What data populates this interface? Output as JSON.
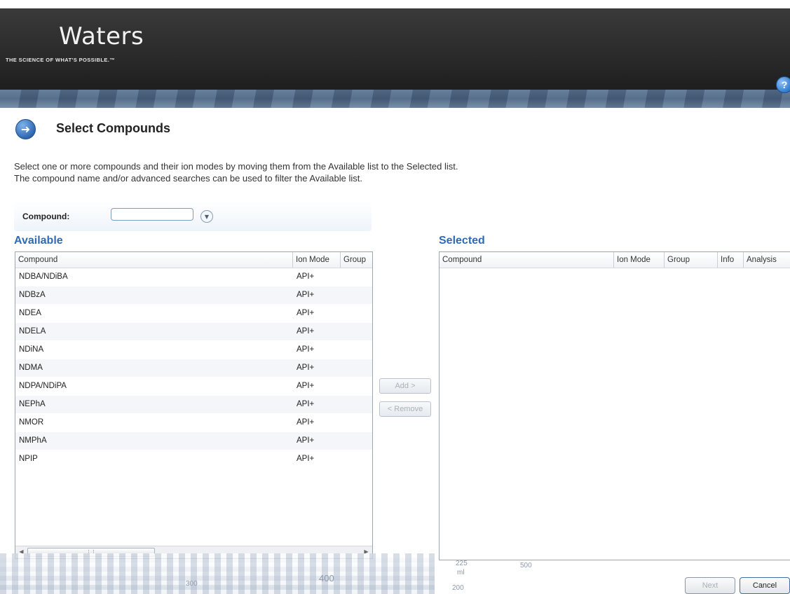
{
  "header": {
    "brand_name": "Waters",
    "tagline": "THE SCIENCE OF WHAT'S POSSIBLE.™",
    "help_label": "?"
  },
  "page": {
    "title": "Select Compounds",
    "instructions": [
      "Select one or more compounds and their ion modes by moving them from the Available list to the Selected list.",
      "The compound name and/or advanced searches can be used to filter the Available list."
    ]
  },
  "filter": {
    "label": "Compound:",
    "value": ""
  },
  "available": {
    "heading": "Available",
    "columns": [
      "Compound",
      "Ion Mode",
      "Group"
    ],
    "rows": [
      {
        "compound": "NDBA/NDiBA",
        "ion_mode": "API+"
      },
      {
        "compound": "NDBzA",
        "ion_mode": "API+"
      },
      {
        "compound": "NDEA",
        "ion_mode": "API+"
      },
      {
        "compound": "NDELA",
        "ion_mode": "API+"
      },
      {
        "compound": "NDiNA",
        "ion_mode": "API+"
      },
      {
        "compound": "NDMA",
        "ion_mode": "API+"
      },
      {
        "compound": "NDPA/NDiPA",
        "ion_mode": "API+"
      },
      {
        "compound": "NEPhA",
        "ion_mode": "API+"
      },
      {
        "compound": "NMOR",
        "ion_mode": "API+"
      },
      {
        "compound": "NMPhA",
        "ion_mode": "API+"
      },
      {
        "compound": "NPIP",
        "ion_mode": "API+"
      }
    ]
  },
  "selected": {
    "heading": "Selected",
    "columns": [
      "Compound",
      "Ion Mode",
      "Group",
      "Info",
      "Analysis"
    ],
    "rows": []
  },
  "actions": {
    "add_label": "Add >",
    "remove_label": "< Remove",
    "next_label": "Next",
    "cancel_label": "Cancel"
  },
  "decor": {
    "labels": [
      "400",
      "300",
      "200",
      "ml",
      "225",
      "500"
    ]
  }
}
